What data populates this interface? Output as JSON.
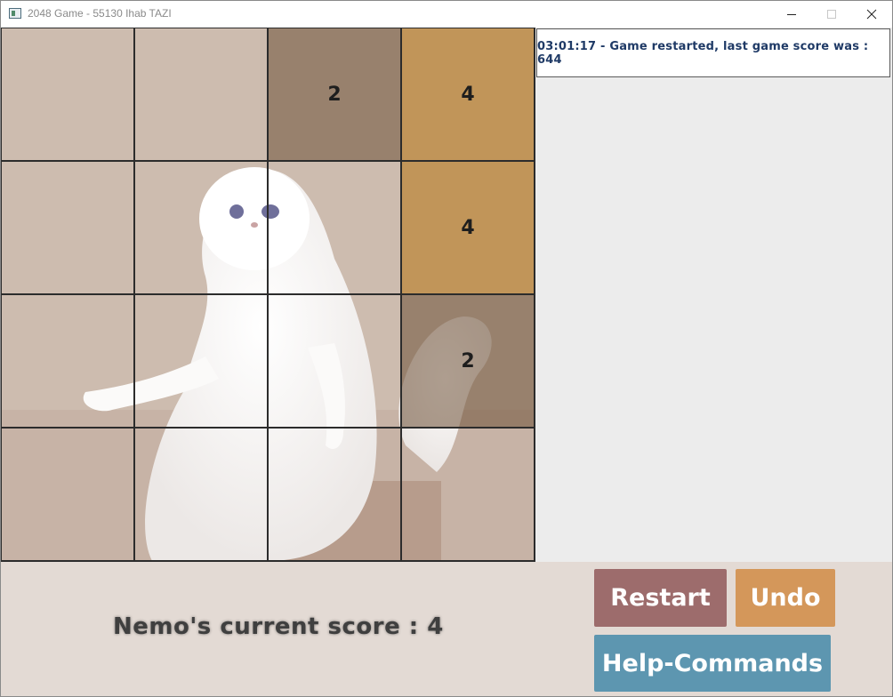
{
  "window": {
    "title": "2048 Game - 55130 Ihab TAZI"
  },
  "board": {
    "background": "Persian cat photo",
    "tiles": [
      [
        "",
        "",
        "2",
        "4"
      ],
      [
        "",
        "",
        "",
        "4"
      ],
      [
        "",
        "",
        "",
        "2"
      ],
      [
        "",
        "",
        "",
        ""
      ]
    ]
  },
  "log": {
    "message": "03:01:17 - Game restarted, last game score was : 644"
  },
  "score": {
    "text": "Nemo's current score : 4"
  },
  "buttons": {
    "restart": "Restart",
    "undo": "Undo",
    "help": "Help-Commands"
  },
  "colors": {
    "restart": "#9d6c6c",
    "undo": "#d4975a",
    "help": "#5d96b0",
    "log_text": "#1f3a66"
  }
}
